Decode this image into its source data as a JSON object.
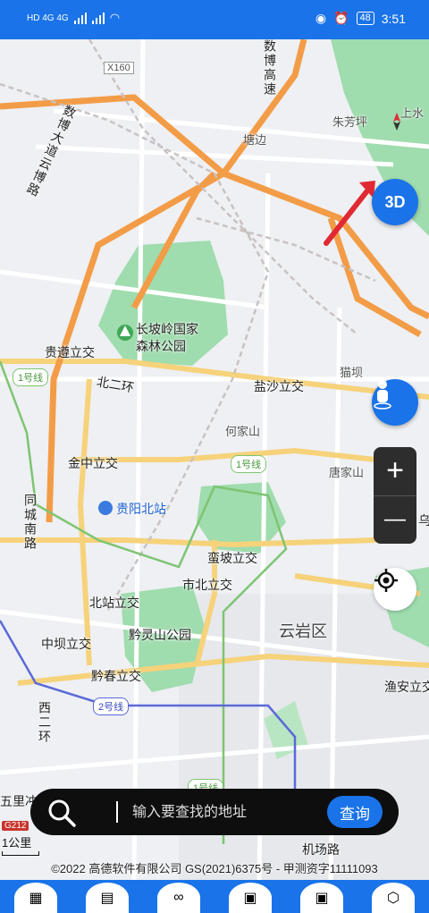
{
  "status_bar": {
    "network_left": "HD 4G 4G",
    "battery": "48",
    "time": "3:51"
  },
  "map": {
    "labels": {
      "x160": "X160",
      "tangbian": "塘边",
      "zhufangping": "朱芳坪",
      "shangshui": "上水",
      "shubo_road": "数博大道云博路",
      "shubo_highway": "数博高速",
      "changpoling": "长坡岭国家",
      "changpoling2": "森林公园",
      "guizun": "贵遵立交",
      "beierhuan": "北二环",
      "yanshaLijiao": "盐沙立交",
      "maoba": "猫坝",
      "hejiashan": "何家山",
      "tangjiashan": "唐家山",
      "jinzhong": "金中立交",
      "tongcheng": "同城南路",
      "guiyang_north": "贵阳北站",
      "manpo": "蛮坡立交",
      "shibei": "市北立交",
      "beizhan": "北站立交",
      "yunyan": "云岩区",
      "qianlingshan": "黔灵山公园",
      "zhongba": "中坝立交",
      "qianchun": "黔春立交",
      "xierhuan": "西二环",
      "yuananli": "渔安立交",
      "wulichong": "五里冲",
      "jichang_road": "机场路",
      "edge_wu": "乌"
    },
    "metro_badges": {
      "line1_left": "1号线",
      "line1_mid": "1号线",
      "line2": "2号线",
      "line1_bottom": "1号线"
    },
    "road_shield": "G212",
    "scale": "1公里"
  },
  "controls": {
    "btn_3d": "3D",
    "zoom_in": "+",
    "zoom_out": "—"
  },
  "search": {
    "placeholder": "输入要查找的地址",
    "button": "查询"
  },
  "copyright": "©2022 高德软件有限公司 GS(2021)6375号 - 甲测资字11111093",
  "colors": {
    "brand_blue": "#1a73e8",
    "park_green": "#9fdcae",
    "road_orange": "#f5b36a",
    "highway_orange": "#f39c47",
    "red_arrow": "#e02a33"
  }
}
